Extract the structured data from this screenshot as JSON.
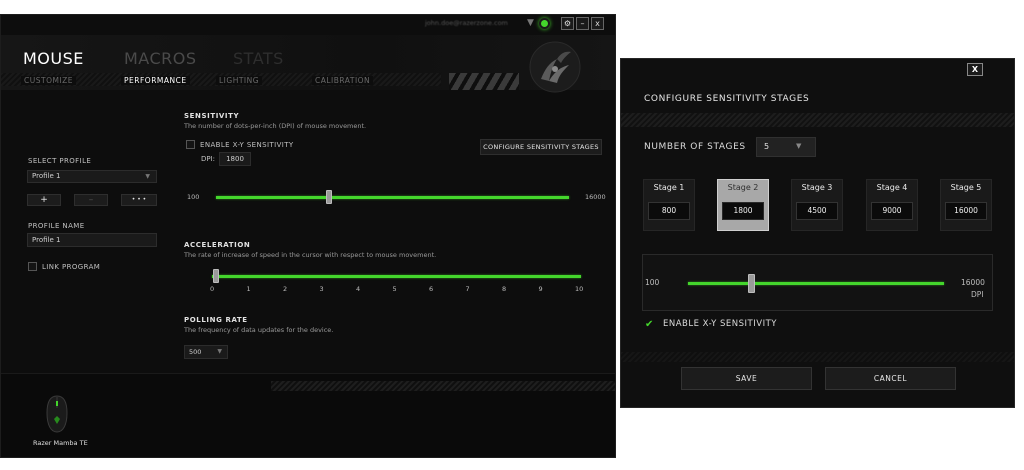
{
  "window": {
    "user_email": "john.doe@razerzone.com",
    "tabs": [
      "MOUSE",
      "MACROS",
      "STATS"
    ],
    "subtabs": [
      "CUSTOMIZE",
      "PERFORMANCE",
      "LIGHTING",
      "CALIBRATION"
    ],
    "window_buttons": {
      "settings": "⚙",
      "minimize": "–",
      "close": "x"
    }
  },
  "profile": {
    "select_label": "SELECT PROFILE",
    "selected": "Profile 1",
    "buttons": {
      "add": "+",
      "remove": "–",
      "more": "• • •"
    },
    "name_label": "PROFILE NAME",
    "name_value": "Profile 1",
    "link_label": "LINK PROGRAM"
  },
  "sensitivity": {
    "title": "SENSITIVITY",
    "description": "The number of dots-per-inch (DPI) of mouse movement.",
    "enable_xy_label": "ENABLE X-Y SENSITIVITY",
    "dpi_label": "DPI:",
    "dpi_value": "1800",
    "configure_button": "CONFIGURE SENSITIVITY STAGES",
    "min_label": "100",
    "max_label": "16000",
    "min": 100,
    "max": 16000,
    "value": 1800
  },
  "acceleration": {
    "title": "ACCELERATION",
    "description": "The rate of increase of speed in the cursor with respect to mouse movement.",
    "ticks": [
      "0",
      "1",
      "2",
      "3",
      "4",
      "5",
      "6",
      "7",
      "8",
      "9",
      "10"
    ],
    "value": 0
  },
  "polling": {
    "title": "POLLING RATE",
    "description": "The frequency of data updates for the device.",
    "value": "500"
  },
  "device": {
    "name": "Razer Mamba TE"
  },
  "dialog": {
    "close_label": "X",
    "title": "CONFIGURE SENSITIVITY STAGES",
    "stages_label": "NUMBER OF STAGES",
    "stages_value": "5",
    "stages": [
      {
        "name": "Stage 1",
        "value": "800"
      },
      {
        "name": "Stage 2",
        "value": "1800"
      },
      {
        "name": "Stage 3",
        "value": "4500"
      },
      {
        "name": "Stage 4",
        "value": "9000"
      },
      {
        "name": "Stage 5",
        "value": "16000"
      }
    ],
    "active_stage": 2,
    "slider_min_label": "100",
    "slider_max_label": "16000",
    "slider_unit": "DPI",
    "slider_value": 1800,
    "enable_xy_label": "ENABLE X-Y SENSITIVITY",
    "save_label": "SAVE",
    "cancel_label": "CANCEL"
  },
  "colors": {
    "accent": "#44d62c",
    "background": "#0d0d0d"
  },
  "icons": {
    "dropdown": "chevron-down-icon",
    "check": "checkmark-icon",
    "status": "online-icon"
  }
}
